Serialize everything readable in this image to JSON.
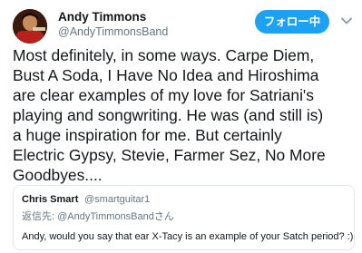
{
  "tweet": {
    "author": {
      "name": "Andy Timmons",
      "handle": "@AndyTimmonsBand"
    },
    "follow_button": {
      "label": "フォロー中"
    },
    "menu_icon": "chevron-down-icon",
    "text": "Most definitely, in some ways. Carpe Diem,\nBust A Soda, I Have No Idea and Hiroshima\nare clear examples of my love for Satriani's\nplaying and songwriting. He was (and still is)\na huge inspiration for me. But certainly\nElectric Gypsy, Stevie, Farmer Sez, No More\nGoodbyes...."
  },
  "quoted_tweet": {
    "author_name": "Chris Smart",
    "author_handle": "@smartguitar1",
    "reply_prefix": "返信先:",
    "reply_to": "@AndyTimmonsBandさん",
    "text": "Andy, would you say that ear X-Tacy is an example of your Satch period? :)"
  },
  "colors": {
    "accent": "#1da1f2",
    "secondary_text": "#657786",
    "primary_text": "#14171a",
    "border": "#e1e8ed"
  }
}
